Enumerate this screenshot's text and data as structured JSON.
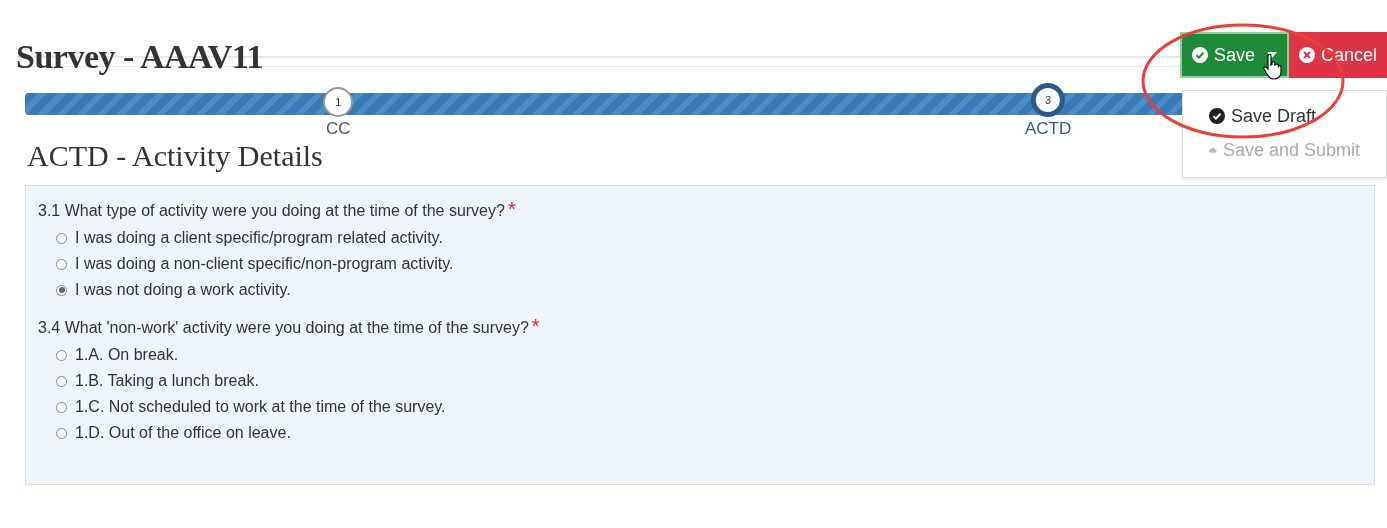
{
  "header": {
    "title": "Survey - AAAV11"
  },
  "actions": {
    "save": {
      "label": "Save",
      "menu_open": true
    },
    "cancel": {
      "label": "Cancel"
    },
    "menu": [
      {
        "label": "Save Draft",
        "disabled": false
      },
      {
        "label": "Save and Submit",
        "disabled": true
      }
    ]
  },
  "progress": {
    "steps": [
      {
        "number": "1",
        "label": "CC",
        "current": false
      },
      {
        "number": "3",
        "label": "ACTD",
        "current": true
      }
    ]
  },
  "section": {
    "title": "ACTD - Activity Details"
  },
  "questions": [
    {
      "text": "3.1 What type of activity were you doing at the time of the survey?",
      "required_mark": "*",
      "options": [
        {
          "label": "I was doing a client specific/program related activity.",
          "selected": false
        },
        {
          "label": "I was doing a non-client specific/non-program activity.",
          "selected": false
        },
        {
          "label": "I was not doing a work activity.",
          "selected": true
        }
      ]
    },
    {
      "text": "3.4 What 'non-work' activity were you doing at the time of the survey?",
      "required_mark": "*",
      "options": [
        {
          "label": "1.A. On break.",
          "selected": false
        },
        {
          "label": "1.B. Taking a lunch break.",
          "selected": false
        },
        {
          "label": "1.C. Not scheduled to work at the time of the survey.",
          "selected": false
        },
        {
          "label": "1.D. Out of the office on leave.",
          "selected": false
        }
      ]
    }
  ]
}
